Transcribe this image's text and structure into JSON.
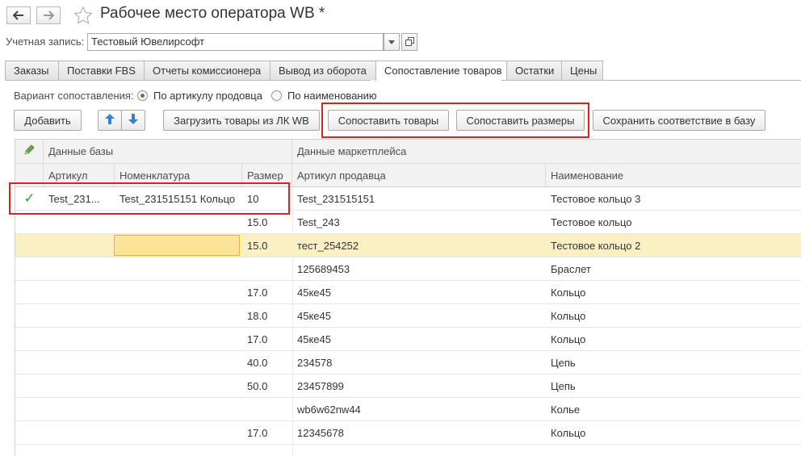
{
  "window": {
    "title": "Рабочее место оператора WB *",
    "back_icon": "arrow-left-icon",
    "forward_icon": "arrow-right-icon",
    "favorite_icon": "star-icon"
  },
  "account": {
    "label": "Учетная запись:",
    "value": "Тестовый Ювелирсофт"
  },
  "tabs": [
    {
      "label": "Заказы"
    },
    {
      "label": "Поставки FBS"
    },
    {
      "label": "Отчеты комиссионера"
    },
    {
      "label": "Вывод из оборота"
    },
    {
      "label": "Сопоставление товаров",
      "active": true
    },
    {
      "label": "Остатки"
    },
    {
      "label": "Цены"
    }
  ],
  "matching": {
    "label": "Вариант сопоставления:",
    "option_article": "По артикулу продовца",
    "option_name": "По наименованию",
    "selected": "article"
  },
  "toolbar": {
    "add": "Добавить",
    "load": "Загрузить товары из ЛК WB",
    "match_goods": "Сопоставить товары",
    "match_sizes": "Сопоставить размеры",
    "save": "Сохранить соответствие в базу"
  },
  "table": {
    "group_base": "Данные базы",
    "group_market": "Данные маркетплейса",
    "columns": {
      "article": "Артикул",
      "nomenclature": "Номенклатура",
      "size": "Размер",
      "seller_article": "Артикул продавца",
      "name": "Наименование"
    },
    "rows": [
      {
        "check": "✓",
        "article": "Test_231...",
        "nomenclature": "Test_231515151 Кольцо",
        "size": "10",
        "seller_article": "Test_231515151",
        "name": "Тестовое кольцо 3"
      },
      {
        "check": "",
        "article": "",
        "nomenclature": "",
        "size": "15.0",
        "seller_article": "Test_243",
        "name": "Тестовое кольцо"
      },
      {
        "check": "",
        "article": "",
        "nomenclature": "",
        "size": "15.0",
        "seller_article": "тест_254252",
        "name": "Тестовое кольцо 2",
        "selected": true
      },
      {
        "check": "",
        "article": "",
        "nomenclature": "",
        "size": "",
        "seller_article": "125689453",
        "name": "Браслет"
      },
      {
        "check": "",
        "article": "",
        "nomenclature": "",
        "size": "17.0",
        "seller_article": "45ке45",
        "name": "Кольцо"
      },
      {
        "check": "",
        "article": "",
        "nomenclature": "",
        "size": "18.0",
        "seller_article": "45ке45",
        "name": "Кольцо"
      },
      {
        "check": "",
        "article": "",
        "nomenclature": "",
        "size": "17.0",
        "seller_article": "45ке45",
        "name": "Кольцо"
      },
      {
        "check": "",
        "article": "",
        "nomenclature": "",
        "size": "40.0",
        "seller_article": "234578",
        "name": "Цепь"
      },
      {
        "check": "",
        "article": "",
        "nomenclature": "",
        "size": "50.0",
        "seller_article": "23457899",
        "name": "Цепь"
      },
      {
        "check": "",
        "article": "",
        "nomenclature": "",
        "size": "",
        "seller_article": "wb6w62nw44",
        "name": "Колье"
      },
      {
        "check": "",
        "article": "",
        "nomenclature": "",
        "size": "17.0",
        "seller_article": "12345678",
        "name": "Кольцо"
      }
    ]
  },
  "colors": {
    "highlight": "#e02020",
    "selected_row": "#fbf0c4",
    "check": "#3a9a3a"
  }
}
